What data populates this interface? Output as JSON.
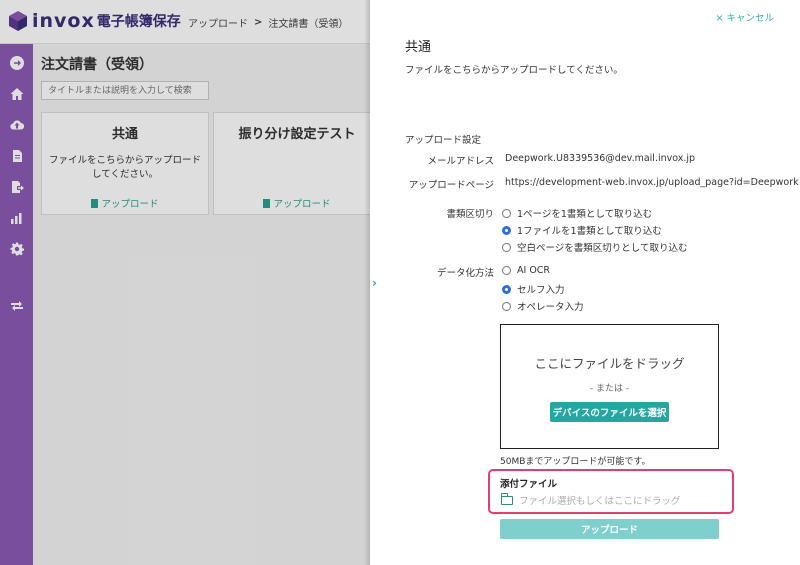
{
  "brand": {
    "name": "invox",
    "product": "電子帳簿保存"
  },
  "breadcrumb": {
    "items": [
      "アップロード",
      "注文請書（受領）"
    ],
    "separator": ">"
  },
  "sidebar": {
    "icons": [
      "arrow-right-circle-icon",
      "home-icon",
      "cloud-upload-icon",
      "document-icon",
      "export-icon",
      "chart-icon",
      "gear-icon",
      "swap-icon"
    ]
  },
  "main": {
    "title": "注文請書（受領）",
    "search_placeholder": "タイトルまたは説明を入力して検索",
    "cards": [
      {
        "title": "共通",
        "desc": "ファイルをこちらからアップロードしてください。",
        "link": "アップロード"
      },
      {
        "title": "振り分け設定テスト",
        "desc": "",
        "link": "アップロード"
      }
    ]
  },
  "panel": {
    "cancel": "キャンセル",
    "title": "共通",
    "desc": "ファイルをこちらからアップロードしてください。",
    "section": "アップロード設定",
    "email_label": "メールアドレス",
    "email_value": "Deepwork.U8339536@dev.mail.invox.jp",
    "page_label": "アップロードページ",
    "page_value": "https://development-web.invox.jp/upload_page?id=Deepwork",
    "split_label": "書類区切り",
    "split_options": [
      {
        "label": "1ページを1書類として取り込む",
        "checked": false
      },
      {
        "label": "1ファイルを1書類として取り込む",
        "checked": true
      },
      {
        "label": "空白ページを書類区切りとして取り込む",
        "checked": false
      }
    ],
    "data_label": "データ化方法",
    "data_options": [
      {
        "label": "AI OCR",
        "checked": false
      },
      {
        "label": "セルフ入力",
        "checked": true
      },
      {
        "label": "オペレータ入力",
        "checked": false
      }
    ],
    "dropzone": {
      "title": "ここにファイルをドラッグ",
      "or": "- または -",
      "button": "デバイスのファイルを選択"
    },
    "limit": "50MBまでアップロードが可能です。",
    "attach": {
      "title": "添付ファイル",
      "placeholder": "ファイル選択もしくはここにドラッグ"
    },
    "upload_button": "アップロード"
  },
  "colors": {
    "accent": "#24a7a1",
    "sidebar": "#8a5ab5",
    "highlight": "#e0406f",
    "brand": "#3b2e7a"
  }
}
